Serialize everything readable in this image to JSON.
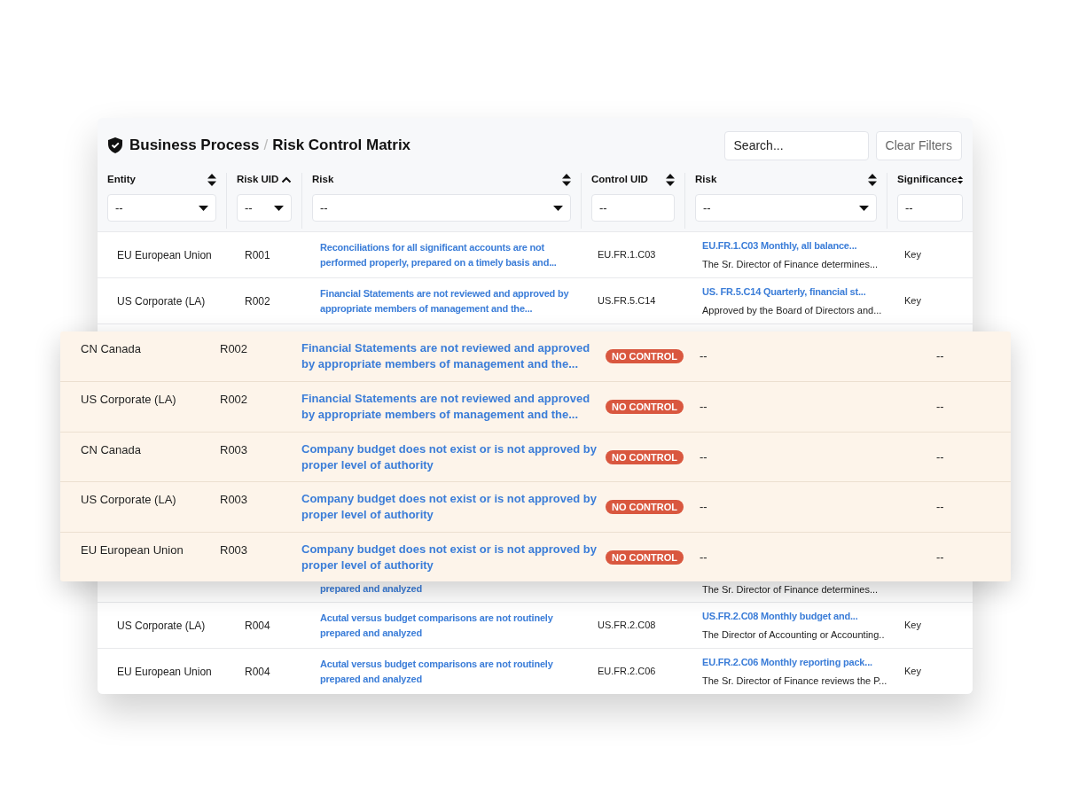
{
  "header": {
    "title": "Business Process",
    "subtitle": "Risk Control Matrix",
    "separator": "/",
    "search": {
      "placeholder": "Search..."
    },
    "clear_button": "Clear Filters"
  },
  "columns": [
    {
      "label": "Entity",
      "sorted_ascending": false,
      "filter": {
        "kind": "select",
        "value": "--"
      }
    },
    {
      "label": "Risk UID",
      "sorted_ascending": true,
      "filter": {
        "kind": "select",
        "value": "--"
      }
    },
    {
      "label": "Risk",
      "sorted_ascending": false,
      "filter": {
        "kind": "select",
        "value": "--"
      }
    },
    {
      "label": "Control UID",
      "sorted_ascending": false,
      "filter": {
        "kind": "text",
        "value": "--"
      }
    },
    {
      "label": "Risk",
      "sorted_ascending": false,
      "filter": {
        "kind": "select",
        "value": "--"
      }
    },
    {
      "label": "Significance",
      "sorted_ascending": false,
      "filter": {
        "kind": "text",
        "value": "--"
      }
    }
  ],
  "rows_top": [
    {
      "entity": "EU European Union",
      "risk_uid": "R001",
      "risk": "Reconciliations for all significant accounts are not performed properly, prepared on a timely basis and...",
      "control_uid": "EU.FR.1.C03",
      "control_title": "EU.FR.1.C03 Monthly, all balance...",
      "control_desc": "The Sr. Director of Finance determines...",
      "significance": "Key"
    },
    {
      "entity": "US Corporate (LA)",
      "risk_uid": "R002",
      "risk": "Financial Statements are not reviewed and approved by appropriate members of management and the...",
      "control_uid": "US.FR.5.C14",
      "control_title": "US. FR.5.C14 Quarterly, financial st...",
      "control_desc": "Approved by the Board of Directors and...",
      "significance": "Key"
    }
  ],
  "partial_row": {
    "risk": "prepared and analyzed",
    "control_desc": "The Sr. Director of Finance determines..."
  },
  "rows_bottom": [
    {
      "entity": "US Corporate (LA)",
      "risk_uid": "R004",
      "risk": "Acutal versus budget comparisons are not routinely prepared and analyzed",
      "control_uid": "US.FR.2.C08",
      "control_title": "US.FR.2.C08 Monthly budget and...",
      "control_desc": "The Director of Accounting or Accounting..",
      "significance": "Key"
    },
    {
      "entity": "EU European Union",
      "risk_uid": "R004",
      "risk": "Acutal versus budget comparisons are not routinely prepared and analyzed",
      "control_uid": "EU.FR.2.C06",
      "control_title": "EU.FR.2.C06 Monthly reporting pack...",
      "control_desc": "The Sr. Director of Finance reviews the P...",
      "significance": "Key"
    }
  ],
  "highlighted_rows": [
    {
      "entity": "CN Canada",
      "risk_uid": "R002",
      "risk": "Financial Statements are not reviewed and approved by appropriate members of management and the...",
      "control": "NO CONTROL",
      "control_title": "--",
      "significance": "--"
    },
    {
      "entity": "US Corporate (LA)",
      "risk_uid": "R002",
      "risk": "Financial Statements are not reviewed and approved by appropriate members of management and the...",
      "control": "NO CONTROL",
      "control_title": "--",
      "significance": "--"
    },
    {
      "entity": "CN Canada",
      "risk_uid": "R003",
      "risk": "Company budget does not exist or is not approved by proper level of authority",
      "control": "NO CONTROL",
      "control_title": "--",
      "significance": "--"
    },
    {
      "entity": "US Corporate (LA)",
      "risk_uid": "R003",
      "risk": "Company budget does not exist or is not approved by proper level of authority",
      "control": "NO CONTROL",
      "control_title": "--",
      "significance": "--"
    },
    {
      "entity": "EU European Union",
      "risk_uid": "R003",
      "risk": "Company budget does not exist or is not approved by proper level of authority",
      "control": "NO CONTROL",
      "control_title": "--",
      "significance": "--"
    }
  ]
}
